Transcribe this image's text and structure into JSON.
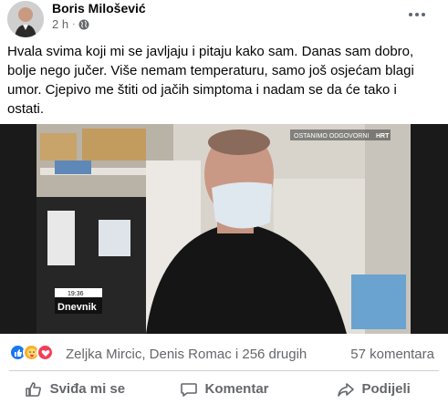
{
  "post": {
    "author": "Boris Milošević",
    "time": "2 h",
    "separator": "·",
    "text": "Hvala svima koji mi se javljaju i pitaju kako sam. Danas sam dobro,\nbolje nego jučer. Više nemam temperaturu, samo još osjećam blagi\numor. Cjepivo me štiti od jačih simptoma i nadam se da će tako i\nostati."
  },
  "video": {
    "overlay_top": "OSTANIMO ODGOVORNI",
    "channel_logo": "HRT",
    "clock": "19:36",
    "program": "Dnevnik"
  },
  "reactions": {
    "icons": [
      "like-icon",
      "care-icon",
      "love-icon"
    ],
    "summary": "Zeljka Mircic, Denis Romac i 256 drugih",
    "comments": "57 komentara"
  },
  "actions": {
    "like": "Sviđa mi se",
    "comment": "Komentar",
    "share": "Podijeli"
  },
  "colors": {
    "secondary_text": "#65676b",
    "like_blue": "#1877f2",
    "love_red": "#f33e58",
    "care_yellow": "#f7b125"
  }
}
